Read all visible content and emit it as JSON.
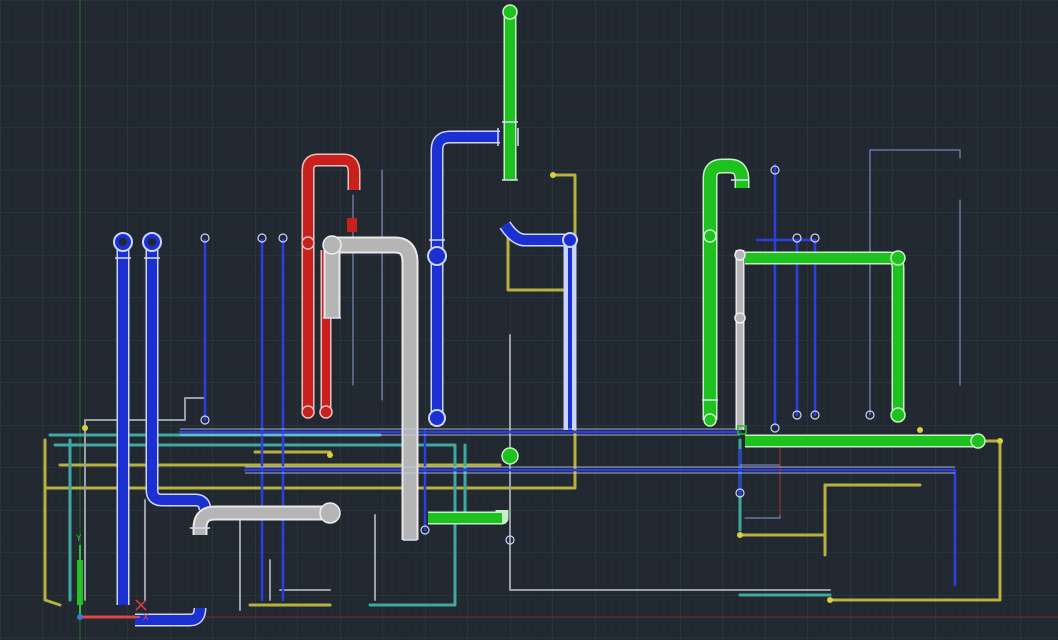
{
  "drawing": {
    "background": "#212830",
    "grid_minor_color": "#2b333d",
    "grid_major_color": "#333d49",
    "axis_x_color": "#7a2a2a",
    "axis_y_color": "#2a6a2a"
  },
  "pipe_colors": {
    "blue": "#1c2fd0",
    "red": "#c8201c",
    "gray": "#b8b8b8",
    "green": "#1ec21e",
    "yellow": "#b8b040",
    "teal": "#3fa8a0",
    "outline": "#c9d6ff"
  },
  "ucs_icon": {
    "x_label": "X",
    "y_label": "Y"
  }
}
